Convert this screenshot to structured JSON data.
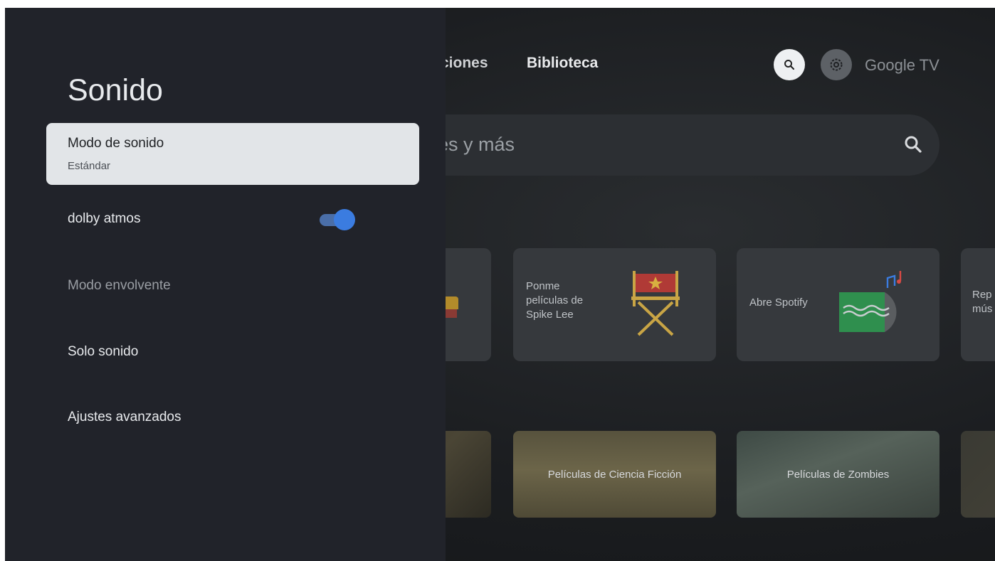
{
  "panel": {
    "title": "Sonido",
    "items": [
      {
        "label": "Modo de sonido",
        "sublabel": "Estándar"
      },
      {
        "label": "dolby atmos",
        "toggle_on": true
      },
      {
        "label": "Modo envolvente"
      },
      {
        "label": "Solo sonido"
      },
      {
        "label": "Ajustes avanzados"
      }
    ]
  },
  "background": {
    "nav": [
      "ciones",
      "Biblioteca"
    ],
    "brand": "Google TV",
    "search_placeholder": "es y más",
    "cards": [
      {
        "text": "Ponme\npelículas de\nSpike Lee"
      },
      {
        "text": "Abre Spotify"
      },
      {
        "text": "Rep\nmús"
      }
    ],
    "row2": [
      "Películas de Ciencia Ficción",
      "Películas de Zombies"
    ]
  },
  "colors": {
    "panel_bg": "#21232a",
    "selected_bg": "#e2e5e8",
    "toggle_on": "#3b7ce0"
  },
  "icons": [
    "search-icon",
    "gear-icon",
    "director-chair-icon",
    "music-note-icon"
  ]
}
